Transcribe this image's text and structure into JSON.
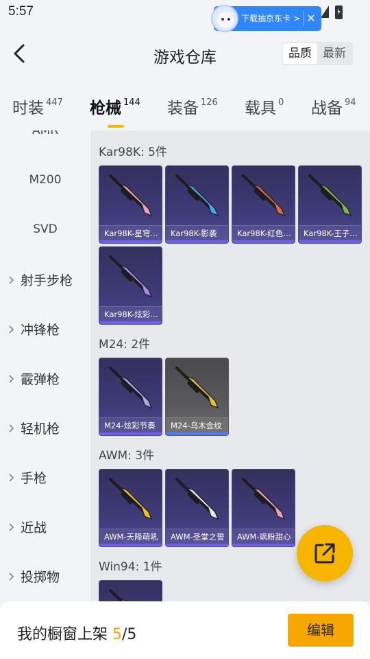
{
  "status_bar": {
    "time": "5:57"
  },
  "ad": {
    "text": "下载抽京东卡 >",
    "close": "✕"
  },
  "header": {
    "title": "游戏仓库",
    "sort_options": [
      "品质",
      "最新"
    ],
    "active_sort": "品质"
  },
  "tabs": [
    {
      "label": "时装",
      "count": "447"
    },
    {
      "label": "枪械",
      "count": "144",
      "active": true
    },
    {
      "label": "装备",
      "count": "126"
    },
    {
      "label": "载具",
      "count": "0"
    },
    {
      "label": "战备",
      "count": "94"
    }
  ],
  "sidebar": {
    "items": [
      {
        "label": "AMR",
        "type": "sub"
      },
      {
        "label": "M200",
        "type": "sub"
      },
      {
        "label": "SVD",
        "type": "sub"
      },
      {
        "label": "射手步枪",
        "type": "category"
      },
      {
        "label": "冲锋枪",
        "type": "category"
      },
      {
        "label": "霰弹枪",
        "type": "category"
      },
      {
        "label": "轻机枪",
        "type": "category"
      },
      {
        "label": "手枪",
        "type": "category"
      },
      {
        "label": "近战",
        "type": "category"
      },
      {
        "label": "投掷物",
        "type": "category"
      }
    ]
  },
  "groups": [
    {
      "title": "Kar98K: 5件",
      "items": [
        {
          "name": "Kar98K-星穹…",
          "accent": "#e8a0b8"
        },
        {
          "name": "Kar98K-影袭",
          "accent": "#4aa8e8"
        },
        {
          "name": "Kar98K-红色…",
          "accent": "#d86a4a"
        },
        {
          "name": "Kar98K-王子…",
          "accent": "#7ab84a"
        },
        {
          "name": "Kar98K-炫彩…",
          "accent": "#a88ae8"
        }
      ]
    },
    {
      "title": "M24: 2件",
      "items": [
        {
          "name": "M24-炫彩节奏",
          "accent": "#a8a8e8"
        },
        {
          "name": "M24-乌木金纹",
          "accent": "#e8c030",
          "style": "gold"
        }
      ]
    },
    {
      "title": "AWM: 3件",
      "items": [
        {
          "name": "AWM-天降萌吼",
          "accent": "#f0c020"
        },
        {
          "name": "AWM-圣堂之誓",
          "accent": "#e8e8e8"
        },
        {
          "name": "AWM-飒粉甜心",
          "accent": "#f0a0b0"
        }
      ]
    },
    {
      "title": "Win94: 1件",
      "items": [
        {
          "name": "",
          "accent": "#e8a070"
        }
      ]
    }
  ],
  "bottom_bar": {
    "label": "我的橱窗上架 ",
    "current": "5",
    "total": "/5",
    "edit": "编辑"
  }
}
